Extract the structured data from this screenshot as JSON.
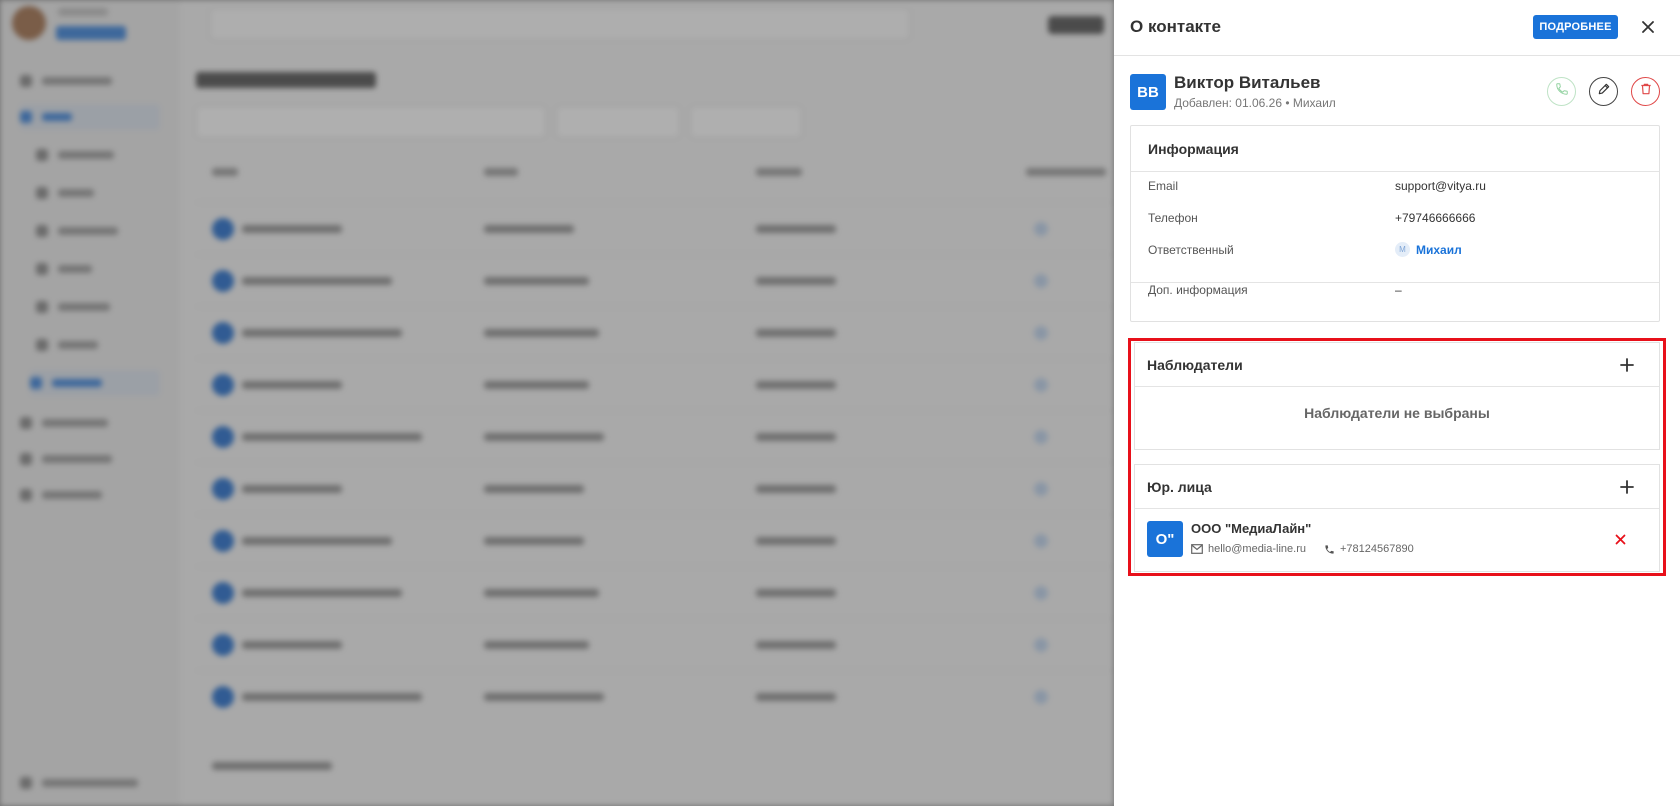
{
  "drawer": {
    "title": "О контакте",
    "details_button": "ПОДРОБНЕЕ"
  },
  "contact": {
    "initials": "ВВ",
    "name": "Виктор Витальев",
    "meta": "Добавлен: 01.06.26 • Михаил"
  },
  "info": {
    "title": "Информация",
    "rows": [
      {
        "label": "Email",
        "value": "support@vitya.ru"
      },
      {
        "label": "Телефон",
        "value": "+79746666666"
      },
      {
        "label": "Ответственный",
        "badge": "М",
        "value": "Михаил"
      },
      {
        "label": "Доп. информация",
        "value": "–"
      }
    ]
  },
  "observers": {
    "title": "Наблюдатели",
    "empty": "Наблюдатели не выбраны"
  },
  "legal": {
    "title": "Юр. лица",
    "items": [
      {
        "initials": "О\"",
        "name": "ООО \"МедиаЛайн\"",
        "email": "hello@media-line.ru",
        "phone": "+78124567890"
      }
    ]
  },
  "colors": {
    "accent": "#1a73d9",
    "danger": "#e04848",
    "highlight": "#e8101a",
    "call": "#8fd19e"
  }
}
